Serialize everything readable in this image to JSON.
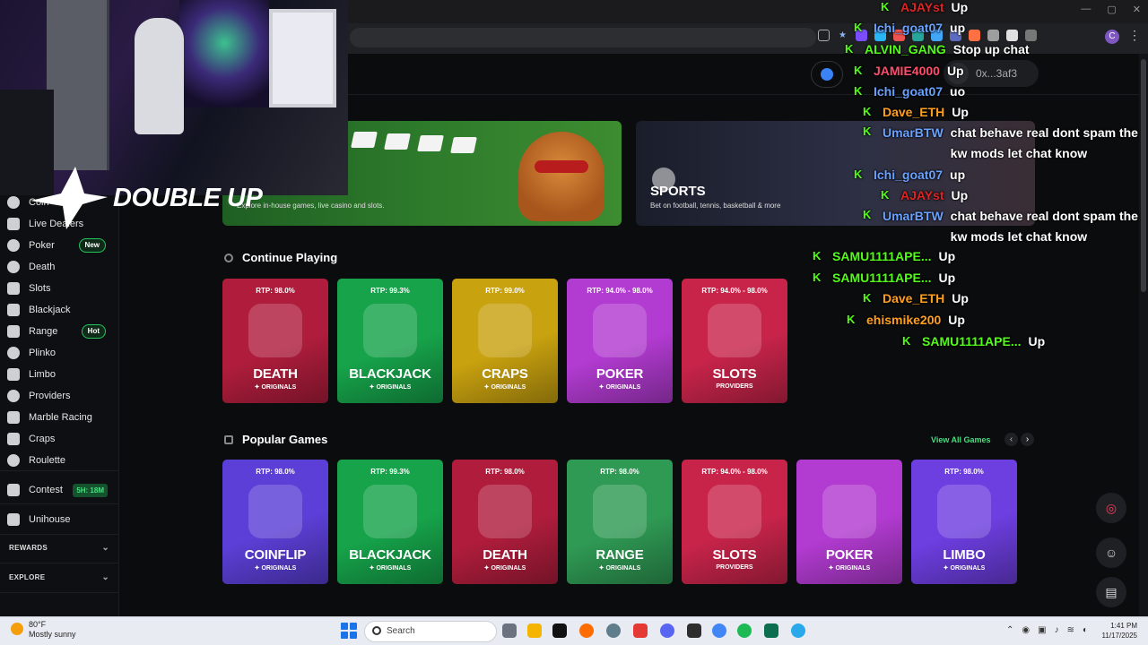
{
  "brand": {
    "logo_text": "DOUBLE UP"
  },
  "header": {
    "account_label": "0x...3af3"
  },
  "sidebar": {
    "items": [
      {
        "label": "Coin",
        "icon": "coin-icon"
      },
      {
        "label": "Live Dealers",
        "icon": "dealer-icon"
      },
      {
        "label": "Poker",
        "icon": "poker-icon",
        "badge": "New"
      },
      {
        "label": "Death",
        "icon": "skull-icon"
      },
      {
        "label": "Slots",
        "icon": "slots-icon"
      },
      {
        "label": "Blackjack",
        "icon": "blackjack-icon"
      },
      {
        "label": "Range",
        "icon": "range-icon",
        "badge": "Hot"
      },
      {
        "label": "Plinko",
        "icon": "plinko-icon"
      },
      {
        "label": "Limbo",
        "icon": "limbo-icon"
      },
      {
        "label": "Providers",
        "icon": "providers-icon"
      },
      {
        "label": "Marble Racing",
        "icon": "flag-icon"
      },
      {
        "label": "Craps",
        "icon": "dice-icon"
      },
      {
        "label": "Roulette",
        "icon": "roulette-icon"
      }
    ],
    "contest": {
      "label": "Contest",
      "timer": "5H: 18M"
    },
    "unihouse": {
      "label": "Unihouse"
    },
    "sections": [
      "REWARDS",
      "EXPLORE"
    ]
  },
  "banners": [
    {
      "title": "",
      "description": "Explore in-house games, live casino and slots."
    },
    {
      "title": "SPORTS",
      "description": "Bet on football, tennis, basketball & more"
    }
  ],
  "continue_playing": {
    "title": "Continue Playing",
    "cards": [
      {
        "rtp": "RTP: 98.0%",
        "name": "DEATH",
        "sub": "✦ ORIGINALS",
        "color": "#b01d3c"
      },
      {
        "rtp": "RTP: 99.3%",
        "name": "BLACKJACK",
        "sub": "✦ ORIGINALS",
        "color": "#16a34a"
      },
      {
        "rtp": "RTP: 99.0%",
        "name": "CRAPS",
        "sub": "✦ ORIGINALS",
        "color": "#c9a20f"
      },
      {
        "rtp": "RTP: 94.0% - 98.0%",
        "name": "POKER",
        "sub": "✦ ORIGINALS",
        "color": "#b23bd1"
      },
      {
        "rtp": "RTP: 94.0% - 98.0%",
        "name": "SLOTS",
        "sub": "PROVIDERS",
        "color": "#c8244a"
      }
    ]
  },
  "popular_games": {
    "title": "Popular Games",
    "view_all": "View All Games",
    "cards": [
      {
        "rtp": "RTP: 98.0%",
        "name": "COINFLIP",
        "sub": "✦ ORIGINALS",
        "color": "#5b3fd6"
      },
      {
        "rtp": "RTP: 99.3%",
        "name": "BLACKJACK",
        "sub": "✦ ORIGINALS",
        "color": "#16a34a"
      },
      {
        "rtp": "RTP: 98.0%",
        "name": "DEATH",
        "sub": "✦ ORIGINALS",
        "color": "#b01d3c"
      },
      {
        "rtp": "RTP: 98.0%",
        "name": "RANGE",
        "sub": "✦ ORIGINALS",
        "color": "#2f9a54"
      },
      {
        "rtp": "RTP: 94.0% - 98.0%",
        "name": "SLOTS",
        "sub": "PROVIDERS",
        "color": "#c8244a"
      },
      {
        "rtp": "",
        "name": "POKER",
        "sub": "✦ ORIGINALS",
        "color": "#b23bd1"
      },
      {
        "rtp": "RTP: 98.0%",
        "name": "LIMBO",
        "sub": "✦ ORIGINALS",
        "color": "#6d3ee0"
      }
    ]
  },
  "chat": [
    {
      "user": "AJAYst",
      "color": "#e02424",
      "msg": "Up"
    },
    {
      "user": "Ichi_goat07",
      "color": "#6aa2ff",
      "msg": "up"
    },
    {
      "user": "ALVIN_GANG",
      "color": "#53fc18",
      "msg": "Stop up chat"
    },
    {
      "user": "JAMIE4000",
      "color": "#ff4d6d",
      "msg": "Up"
    },
    {
      "user": "Ichi_goat07",
      "color": "#6aa2ff",
      "msg": "uo"
    },
    {
      "user": "Dave_ETH",
      "color": "#ff9f1c",
      "msg": "Up"
    },
    {
      "user": "UmarBTW",
      "color": "#6aa2ff",
      "msg": "chat behave real dont spam the kw mods let chat know"
    },
    {
      "user": "Ichi_goat07",
      "color": "#6aa2ff",
      "msg": "up"
    },
    {
      "user": "AJAYst",
      "color": "#e02424",
      "msg": "Up"
    },
    {
      "user": "UmarBTW",
      "color": "#6aa2ff",
      "msg": "chat behave real dont spam the kw mods let chat know"
    },
    {
      "user": "SAMU1111APE...",
      "color": "#53fc18",
      "msg": "Up"
    },
    {
      "user": "SAMU1111APE...",
      "color": "#53fc18",
      "msg": "Up"
    },
    {
      "user": "Dave_ETH",
      "color": "#ff9f1c",
      "msg": "Up"
    },
    {
      "user": "ehismike200",
      "color": "#ff9f1c",
      "msg": "Up"
    },
    {
      "user": "SAMU1111APE...",
      "color": "#53fc18",
      "msg": "Up"
    }
  ],
  "taskbar": {
    "weather_temp": "80°F",
    "weather_desc": "Mostly sunny",
    "search_placeholder": "Search",
    "time": "1:41 PM",
    "date": "11/17/2025"
  }
}
